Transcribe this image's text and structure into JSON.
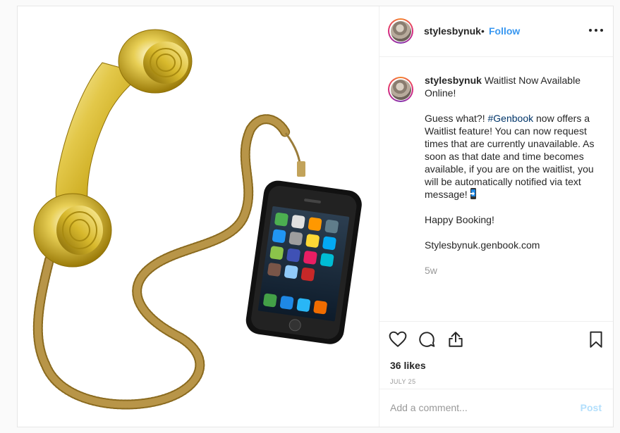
{
  "post": {
    "username": "stylesbynuk",
    "dot": "•",
    "follow_label": "Follow",
    "caption": {
      "title": "Waitlist Now Available Online!",
      "p2_before": "Guess what?! ",
      "hashtag": "#Genbook",
      "p2_after": " now offers a Waitlist feature! You can now request times that are currently unavailable. As soon as that date and time becomes available, if you are on the waitlist, you will be automatically notified via text message!",
      "p3": "Happy Booking!",
      "p4": "Stylesbynuk.genbook.com"
    },
    "time_ago": "5w",
    "likes": "36 likes",
    "date": "JULY 25",
    "comment_placeholder": "Add a comment...",
    "post_label": "Post"
  },
  "icons": {
    "like": "heart-icon",
    "comment": "comment-icon",
    "share": "share-icon",
    "save": "bookmark-icon",
    "more": "more-options-icon"
  },
  "colors": {
    "link": "#3897f0",
    "hashtag": "#003569",
    "muted": "#999999",
    "post_disabled": "#b2dffc"
  }
}
